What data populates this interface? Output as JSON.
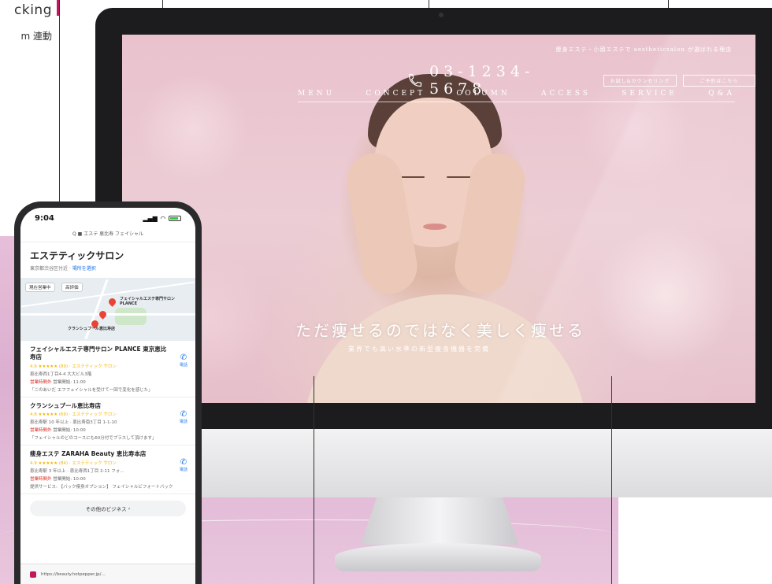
{
  "caption": {
    "line1": "cking",
    "line2": "m 連動"
  },
  "website": {
    "tagline": "痩身エステ・小顔エステで aestheticsalon が選ばれる理由",
    "phone_number": "03-1234-5678",
    "header_buttons": [
      "お試し&カウンセリング",
      "ご予約はこちら"
    ],
    "nav": [
      "MENU",
      "CONCEPT",
      "COLUMN",
      "ACCESS",
      "SERVICE",
      "Q&A"
    ],
    "headline": "ただ痩せるのではなく美しく痩せる",
    "subheadline": "業界でも高い水準の新型痩身機器を完備"
  },
  "mobile": {
    "time": "9:04",
    "query": "Q ■ エステ 恵比寿 フェイシャル",
    "results_title": "エステティックサロン",
    "results_sub": "東京都渋谷区付近 ·",
    "results_sub_link": "場所を選択",
    "map_chips": [
      "現在営業中",
      "高評価"
    ],
    "map_labels": [
      "フェイシャルエステ専門サロン PLANCE",
      "クランシュプール恵比寿店"
    ],
    "listings": [
      {
        "name": "フェイシャルエステ専門サロン PLANCE 東京恵比寿店",
        "rating": "4.9 ★★★★★ (89) · エステティック サロン",
        "address": "恵比寿西1丁目4-4 大大ビル3階",
        "hours_status": "営業時間外",
        "hours": "営業開始: 11:00",
        "review": "「このあいだ エフフェイシャルを受けて一回で変化を感じた」",
        "call": "電話"
      },
      {
        "name": "クランシュプール恵比寿店",
        "rating": "4.8 ★★★★★ (69) · エステティック サロン",
        "address": "恵比寿駅 10 年以上 · 恵比寿南3丁目 1-1-10",
        "hours_status": "営業時間外",
        "hours": "営業開始: 10:00",
        "review": "「フェイシャルのどのコースにも60分付でプラスして頂けます」",
        "call": "電話"
      },
      {
        "name": "痩身エステ ZARAHA Beauty 恵比寿本店",
        "rating": "4.9 ★★★★★ (84) · エステティック サロン",
        "address": "恵比寿駅 3 年以上 · 恵比寿西1丁目 2-11 フォ...",
        "hours_status": "営業時間外",
        "hours": "営業開始: 10:00",
        "review": "提供サービス: 【バック痩身オプション】 フェイシャルビフォートバック",
        "call": "電話"
      }
    ],
    "more_button": "その他のビジネス",
    "url": "https://beauty.hotpepper.jp/..."
  },
  "colors": {
    "accent": "#c2185b",
    "pink_band": "#e2b6d6",
    "monitor_bezel": "#1c1c1e",
    "link": "#1a73e8",
    "star": "#f4b400"
  }
}
